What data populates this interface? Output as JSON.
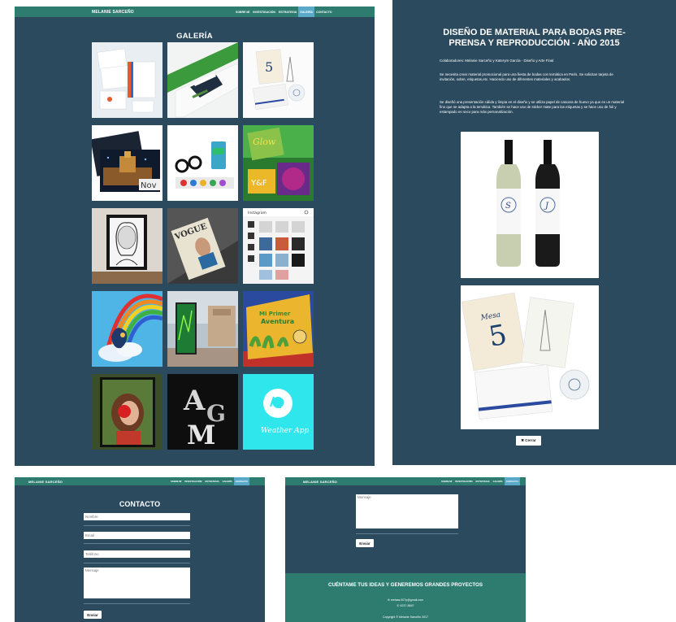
{
  "site": {
    "brand": "MELANIE SARCEÑO",
    "nav_items": [
      "SOBRE MÍ",
      "INVESTIGACIÓN",
      "ESTRATEGIA",
      "GALERÍA",
      "CONTACTO"
    ]
  },
  "galeria": {
    "title": "GALERÍA",
    "active_nav": "GALERÍA",
    "tiles": [
      {
        "id": "papeleria",
        "thumb_text": ""
      },
      {
        "id": "sobres",
        "thumb_text": ""
      },
      {
        "id": "boda",
        "thumb_text": "5"
      },
      {
        "id": "noche",
        "thumb_text": "Nov"
      },
      {
        "id": "gafas",
        "thumb_text": ""
      },
      {
        "id": "glow",
        "thumb_text": "Glow"
      },
      {
        "id": "retrato",
        "thumb_text": ""
      },
      {
        "id": "revista",
        "thumb_text": "VOGUE"
      },
      {
        "id": "instagram",
        "thumb_text": "Instagram"
      },
      {
        "id": "arcoiris",
        "thumb_text": ""
      },
      {
        "id": "cartel",
        "thumb_text": ""
      },
      {
        "id": "aventura",
        "thumb_text": "Mi Primer Aventura"
      },
      {
        "id": "mujer",
        "thumb_text": ""
      },
      {
        "id": "letras",
        "thumb_text": "AGM"
      },
      {
        "id": "weather",
        "thumb_text": "Weather App"
      }
    ]
  },
  "detalle": {
    "title": "DISEÑO DE MATERIAL PARA BODAS PRE-PRENSA Y REPRODUCCIÓN - AÑO 2015",
    "collaborators": "Colaboradores: Melanie Sarceño y Katerym García - Diseño y Arte Final",
    "paragraph1": "Se necesita crear material promocional para una fiesta de bodas con temática en París. Se solicitan tarjeta de invitación, sobre, etiquetas,etc. Haciendo uso de diferentes materiales y acabados.",
    "paragraph2": "Se diseñó una presentación cálida y limpia en el diseño y se utiliza papel de cascara de huevo ya que es un material fino que se adapta a la temática. También se hace uso de sticker mate para las etiquetas y se hace uso de foil y estampado en seco para más personalización.",
    "close_label": "✖ Cerrar",
    "bottle_monograms": [
      "S",
      "J"
    ],
    "table_card": {
      "word": "Mesa",
      "number": "5"
    }
  },
  "contacto": {
    "title": "CONTACTO",
    "active_nav": "CONTACTO",
    "fields": {
      "name_placeholder": "Nombre",
      "email_placeholder": "Email",
      "phone_placeholder": "Teléfono",
      "message_placeholder": "Mensaje"
    },
    "send_label": "Enviar"
  },
  "footer": {
    "message_placeholder": "Mensaje",
    "send_label": "Enviar",
    "slogan": "CUÉNTAME TUS IDEAS Y GENEREMOS GRANDES PROYECTOS",
    "email": "✉ melsas.007y@gmail.com",
    "phone": "✆ 4237-8647",
    "copyright": "Copyright © Melanie Sarceño 2017"
  },
  "colors": {
    "page_bg": "#2b4a5e",
    "navbar_bg": "#2e7b70",
    "active_nav": "#5aa9c9"
  }
}
